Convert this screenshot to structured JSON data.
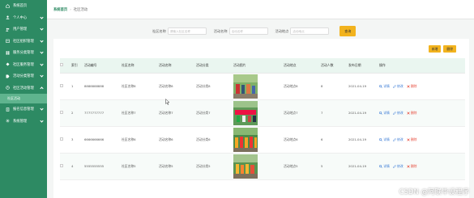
{
  "sidebar": {
    "items": [
      {
        "label": "系统首页",
        "icon": "home-icon",
        "expandable": false
      },
      {
        "label": "个人中心",
        "icon": "user-icon",
        "expandable": true
      },
      {
        "label": "用户管理",
        "icon": "users-icon",
        "expandable": true
      },
      {
        "label": "社区组织管理",
        "icon": "org-icon",
        "expandable": true
      },
      {
        "label": "服务分类管理",
        "icon": "category-icon",
        "expandable": true
      },
      {
        "label": "社区服务管理",
        "icon": "service-icon",
        "expandable": true
      },
      {
        "label": "活动分类管理",
        "icon": "tag-icon",
        "expandable": true
      },
      {
        "label": "社区活动管理",
        "icon": "activity-icon",
        "expandable": true,
        "open": true
      },
      {
        "label": "社区活动",
        "sub": true
      },
      {
        "label": "报名信息管理",
        "icon": "form-icon",
        "expandable": true
      },
      {
        "label": "系统管理",
        "icon": "gear-icon",
        "expandable": true
      }
    ]
  },
  "breadcrumb": {
    "home": "系统首页",
    "current": "社区活动"
  },
  "search": {
    "f1_label": "社区名称",
    "f1_placeholder": "请输入社区名称",
    "f2_label": "活动名称",
    "f2_placeholder": "活动名称",
    "f3_label": "活动地点",
    "f3_placeholder": "活动地点",
    "query": "查询"
  },
  "actions": {
    "add": "新增",
    "delete": "删除"
  },
  "table": {
    "headers": [
      "",
      "索引",
      "活动编号",
      "社区名称",
      "活动名称",
      "活动分类",
      "活动图片",
      "活动地点",
      "活动人数",
      "发布日期",
      "操作"
    ],
    "rows": [
      {
        "idx": "1",
        "code": "8888888888",
        "community": "社区名称8",
        "name": "活动名称8",
        "category": "活动分类8",
        "place": "活动地点8",
        "count": "8",
        "date": "2021-04-19"
      },
      {
        "idx": "2",
        "code": "7777777777",
        "community": "社区名称7",
        "name": "活动名称7",
        "category": "活动分类7",
        "place": "活动地点7",
        "count": "7",
        "date": "2021-04-19"
      },
      {
        "idx": "3",
        "code": "6666666666",
        "community": "社区名称6",
        "name": "活动名称6",
        "category": "活动分类6",
        "place": "活动地点6",
        "count": "6",
        "date": "2021-04-19"
      },
      {
        "idx": "4",
        "code": "5555555555",
        "community": "社区名称5",
        "name": "活动名称5",
        "category": "活动分类5",
        "place": "活动地点5",
        "count": "5",
        "date": "2021-04-19"
      }
    ],
    "ops": {
      "view": "详情",
      "edit": "修改",
      "del": "删除"
    }
  },
  "watermark": "CSDN @阿联毕设程序",
  "colors": {
    "sidebar": "#2d8a63",
    "accent": "#f2b31e",
    "header_row": "#eaf6f0"
  }
}
